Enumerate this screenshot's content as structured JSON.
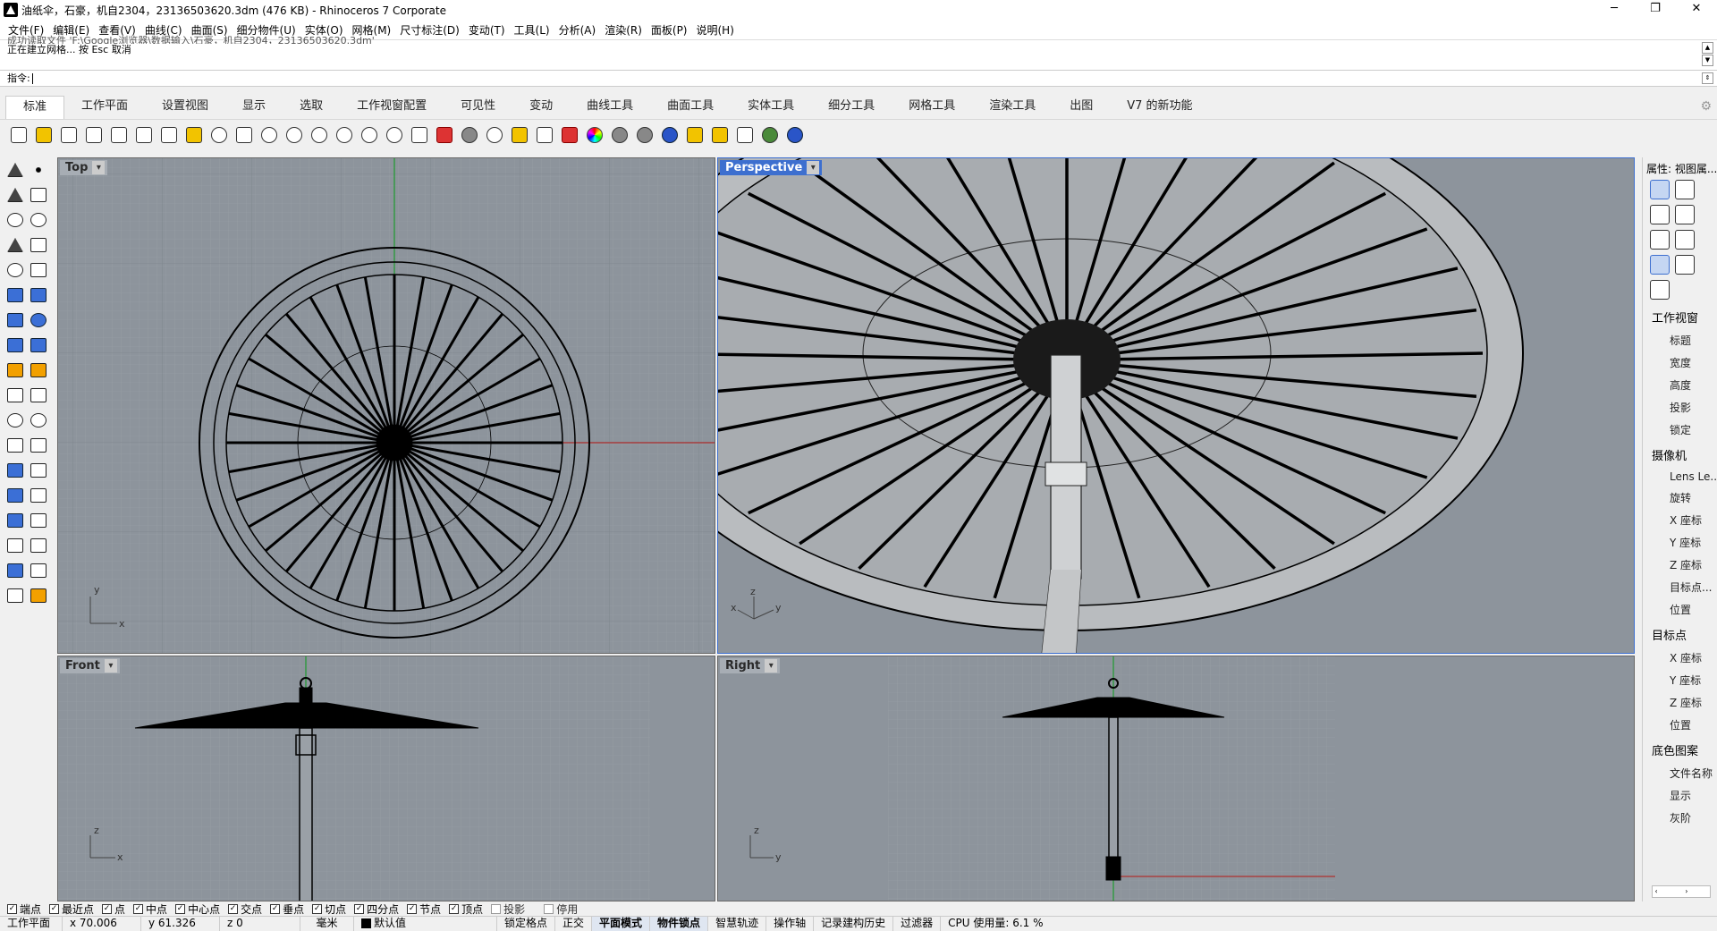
{
  "window": {
    "title": "油纸伞，石豪，机自2304，23136503620.3dm (476 KB) - Rhinoceros 7 Corporate",
    "minimize": "─",
    "maximize": "❐",
    "close": "✕"
  },
  "menu": [
    "文件(F)",
    "编辑(E)",
    "查看(V)",
    "曲线(C)",
    "曲面(S)",
    "细分物件(U)",
    "实体(O)",
    "网格(M)",
    "尺寸标注(D)",
    "变动(T)",
    "工具(L)",
    "分析(A)",
    "渲染(R)",
    "面板(P)",
    "说明(H)"
  ],
  "history": {
    "line1": "成功读取文件 'F:\\Google浏览器\\数据输入\\石豪，机自2304，23136503620.3dm'",
    "line2": "正在建立网格... 按 Esc 取消"
  },
  "command": {
    "prompt": "指令:"
  },
  "tabs": [
    "标准",
    "工作平面",
    "设置视图",
    "显示",
    "选取",
    "工作视窗配置",
    "可见性",
    "变动",
    "曲线工具",
    "曲面工具",
    "实体工具",
    "细分工具",
    "网格工具",
    "渲染工具",
    "出图",
    "V7 的新功能"
  ],
  "toolbar_icons": [
    "new-icon",
    "open-icon",
    "save-icon",
    "print-icon",
    "import-icon",
    "cut-icon",
    "copy-icon",
    "paste-icon",
    "undo-icon",
    "pan-icon",
    "rotate-view-icon",
    "zoom-icon",
    "zoom-window-icon",
    "zoom-extents-icon",
    "zoom-selected-icon",
    "rotate-icon",
    "four-views-icon",
    "car-icon",
    "render-icon",
    "shade-icon",
    "light-icon",
    "lock-icon",
    "layer-icon",
    "color-wheel-icon",
    "sphere-icon",
    "material-icon",
    "globe-icon",
    "select-icon",
    "gear-settings-icon",
    "dimension-icon",
    "grasshopper-icon",
    "help-icon"
  ],
  "viewports": {
    "top": "Top",
    "perspective": "Perspective",
    "front": "Front",
    "right": "Right"
  },
  "axes": {
    "x": "x",
    "y": "y",
    "z": "z"
  },
  "properties": {
    "header": "属性: 视图属...",
    "section_viewport": "工作视窗",
    "viewport_items": [
      "标题",
      "宽度",
      "高度",
      "投影",
      "锁定"
    ],
    "section_camera": "摄像机",
    "camera_items": [
      "Lens Le...",
      "旋转",
      "X 座标",
      "Y 座标",
      "Z 座标",
      "目标点...",
      "位置"
    ],
    "section_target": "目标点",
    "target_items": [
      "X 座标",
      "Y 座标",
      "Z 座标",
      "位置"
    ],
    "section_wallpaper": "底色图案",
    "wallpaper_items": [
      "文件名称",
      "显示",
      "灰阶"
    ]
  },
  "snaps": [
    {
      "label": "端点",
      "on": true
    },
    {
      "label": "最近点",
      "on": true
    },
    {
      "label": "点",
      "on": true
    },
    {
      "label": "中点",
      "on": true
    },
    {
      "label": "中心点",
      "on": true
    },
    {
      "label": "交点",
      "on": true
    },
    {
      "label": "垂点",
      "on": true
    },
    {
      "label": "切点",
      "on": true
    },
    {
      "label": "四分点",
      "on": true
    },
    {
      "label": "节点",
      "on": true
    },
    {
      "label": "顶点",
      "on": true
    },
    {
      "label": "投影",
      "on": false
    },
    {
      "label": "停用",
      "on": false
    }
  ],
  "status": {
    "cplane": "工作平面",
    "x": "x 70.006",
    "y": "y 61.326",
    "z": "z 0",
    "units": "毫米",
    "layer": "默认值",
    "grid_snap": "锁定格点",
    "ortho": "正交",
    "planar": "平面模式",
    "osnap": "物件锁点",
    "smarttrack": "智慧轨迹",
    "gumball": "操作轴",
    "history": "记录建构历史",
    "filter": "过滤器",
    "cpu": "CPU 使用量: 6.1 %"
  }
}
